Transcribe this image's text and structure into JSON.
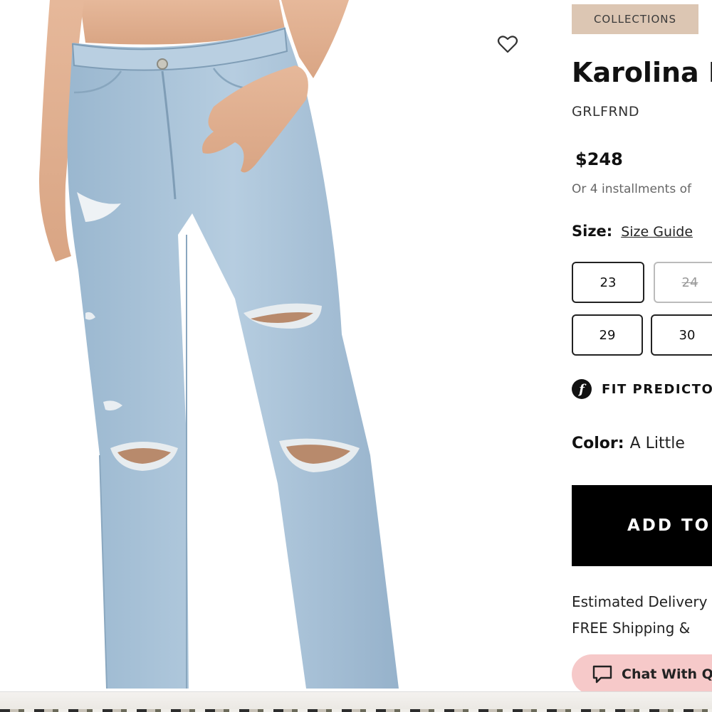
{
  "product_image": {
    "alt": "Light wash distressed jeans",
    "wishlist_icon": "heart-outline-icon"
  },
  "product": {
    "badge": "COLLECTIONS",
    "title": "Karolina H",
    "brand": "GRLFRND",
    "price": "$248",
    "installments": "Or 4 installments of"
  },
  "size": {
    "label": "Size:",
    "guide_label": "Size Guide",
    "options": [
      {
        "label": "23",
        "available": true
      },
      {
        "label": "24",
        "available": false
      },
      {
        "label": "29",
        "available": true
      },
      {
        "label": "30",
        "available": true
      }
    ]
  },
  "fit_predictor": {
    "icon": "f",
    "label": "FIT PREDICTOR"
  },
  "color": {
    "label": "Color:",
    "value": "A Little"
  },
  "cart": {
    "add_label": "ADD TO"
  },
  "delivery": {
    "line1": "Estimated Delivery",
    "line2": "FREE Shipping &"
  },
  "chat": {
    "label": "Chat With Q",
    "icon": "chat-bubble-icon",
    "color": "#f6c9c9"
  },
  "colors": {
    "badge_bg": "#dcc6b3",
    "add_button_bg": "#000000",
    "denim": "#a9c3d8"
  }
}
